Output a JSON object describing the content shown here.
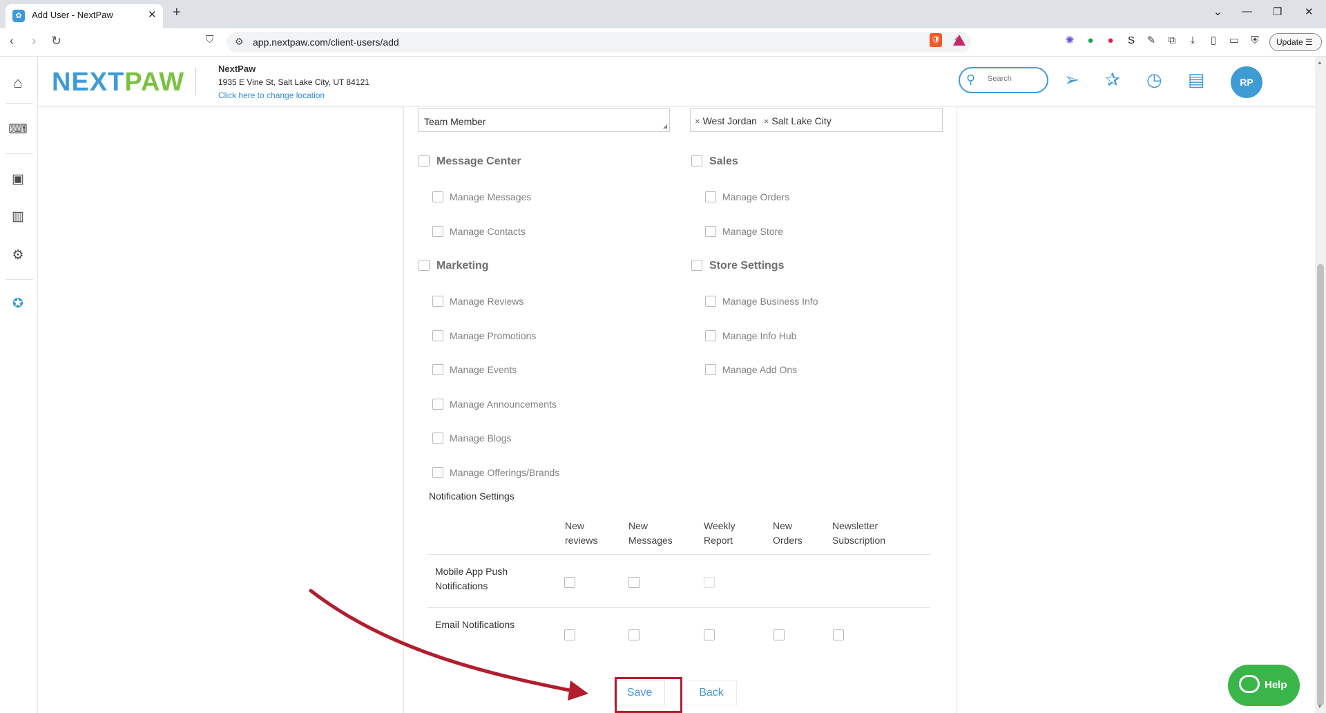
{
  "browser": {
    "tab_title": "Add User - NextPaw",
    "url": "app.nextpaw.com/client-users/add",
    "update_label": "Update"
  },
  "header": {
    "logo_next": "NEXT",
    "logo_paw": "PAW",
    "business_name": "NextPaw",
    "business_address": "1935 E Vine St, Salt Lake City, UT 84121",
    "change_location": "Click here to change location",
    "search_placeholder": "Search",
    "avatar_initials": "RP"
  },
  "form": {
    "role_value": "Team Member",
    "locations": [
      "West Jordan",
      "Salt Lake City"
    ],
    "permissions": {
      "message_center": "Message Center",
      "manage_messages": "Manage Messages",
      "manage_contacts": "Manage Contacts",
      "marketing": "Marketing",
      "manage_reviews": "Manage Reviews",
      "manage_promotions": "Manage Promotions",
      "manage_events": "Manage Events",
      "manage_announcements": "Manage Announcements",
      "manage_blogs": "Manage Blogs",
      "manage_offerings": "Manage Offerings/Brands",
      "sales": "Sales",
      "manage_orders": "Manage Orders",
      "manage_store": "Manage Store",
      "store_settings": "Store Settings",
      "manage_business_info": "Manage Business Info",
      "manage_info_hub": "Manage Info Hub",
      "manage_add_ons": "Manage Add Ons"
    },
    "notification_title": "Notification Settings",
    "columns": [
      [
        "New",
        "reviews"
      ],
      [
        "New",
        "Messages"
      ],
      [
        "Weekly",
        "Report"
      ],
      [
        "New",
        "Orders"
      ],
      [
        "Newsletter",
        "Subscription"
      ]
    ],
    "rows": {
      "push_line1": "Mobile App Push",
      "push_line2": "Notifications",
      "email": "Email Notifications"
    },
    "save_label": "Save",
    "back_label": "Back"
  },
  "help_label": "Help",
  "annotation_color": "#b01e2d"
}
